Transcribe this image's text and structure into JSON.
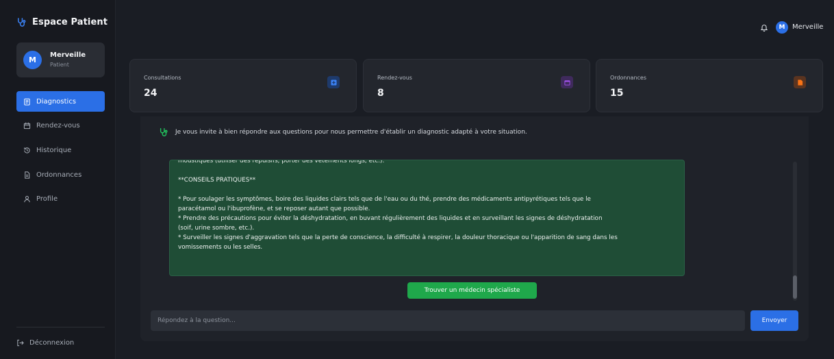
{
  "sidebar": {
    "brand_title": "Espace Patient",
    "user": {
      "initial": "M",
      "name": "Merveille",
      "role": "Patient"
    },
    "items": [
      {
        "label": "Diagnostics",
        "icon": "clipboard-icon",
        "active": true
      },
      {
        "label": "Rendez-vous",
        "icon": "calendar-icon",
        "active": false
      },
      {
        "label": "Historique",
        "icon": "history-icon",
        "active": false
      },
      {
        "label": "Ordonnances",
        "icon": "document-icon",
        "active": false
      },
      {
        "label": "Profile",
        "icon": "user-icon",
        "active": false
      }
    ],
    "logout_label": "Déconnexion"
  },
  "topbar": {
    "avatar_initial": "M",
    "user_name": "Merveille"
  },
  "stats": [
    {
      "label": "Consultations",
      "value": "24",
      "icon": "plus-square-icon",
      "color": "#3b82f6"
    },
    {
      "label": "Rendez-vous",
      "value": "8",
      "icon": "calendar-icon",
      "color": "#a855f7"
    },
    {
      "label": "Ordonnances",
      "value": "15",
      "icon": "file-icon",
      "color": "#f97316"
    }
  ],
  "chat": {
    "intro": "Je vous invite à bien répondre aux questions pour nous permettre d'établir un diagnostic adapté à votre situation.",
    "message_lines": [
      "moustiques (utiliser des répulsifs, porter des vêtements longs, etc.).",
      "",
      "**CONSEILS PRATIQUES**",
      "",
      "* Pour soulager les symptômes, boire des liquides clairs tels que de l'eau ou du thé, prendre des médicaments antipyrétiques tels que le",
      "paracétamol ou l'ibuprofène, et se reposer autant que possible.",
      "* Prendre des précautions pour éviter la déshydratation, en buvant régulièrement des liquides et en surveillant les signes de déshydratation",
      "(soif, urine sombre, etc.).",
      "* Surveiller les signes d'aggravation tels que la perte de conscience, la difficulté à respirer, la douleur thoracique ou l'apparition de sang dans les",
      "vomissements ou les selles."
    ],
    "find_doctor_label": "Trouver un médecin spécialiste",
    "input_placeholder": "Répondez à la question...",
    "send_label": "Envoyer"
  },
  "colors": {
    "accent": "#2b6fe6",
    "success": "#1fa84b",
    "message_bg": "#1f4d36"
  }
}
